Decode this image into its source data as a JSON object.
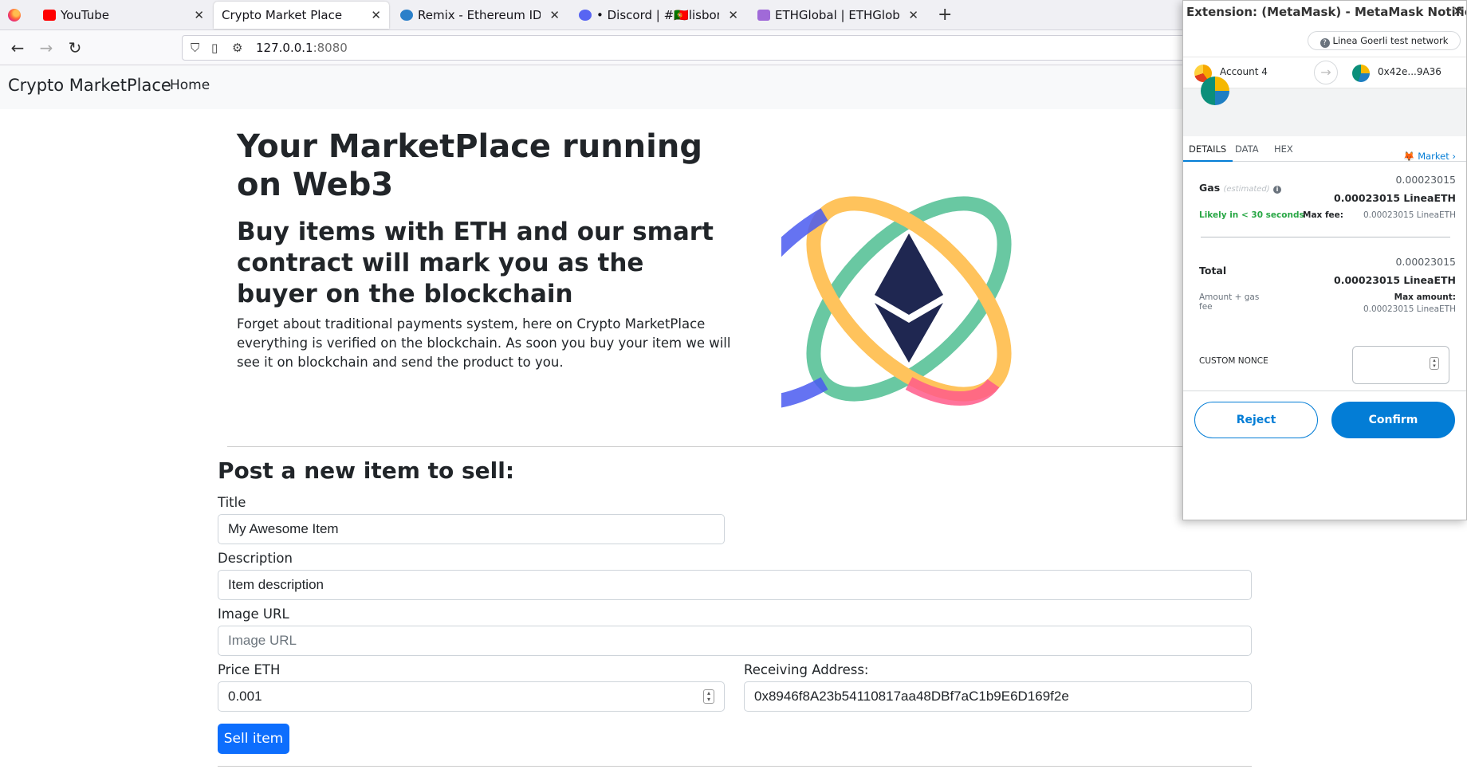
{
  "browser": {
    "tabs": [
      {
        "label": "YouTube",
        "fav_color": "#ff0000"
      },
      {
        "label": "Crypto Market Place",
        "fav_color": "",
        "active": true
      },
      {
        "label": "Remix - Ethereum IDE",
        "fav_color": "#2a7fc9"
      },
      {
        "label": "• Discord | #🇵🇹lisbon-chat",
        "fav_color": "#5865f2"
      },
      {
        "label": "ETHGlobal | ETHGlobal Li",
        "fav_color": "#a06ad8"
      }
    ],
    "url_host": "127.0.0.1",
    "url_port": ":8080"
  },
  "site": {
    "brand": "Crypto MarketPlace",
    "nav_home": "Home",
    "hero_title": "Your MarketPlace running on Web3",
    "hero_subtitle": "Buy items with ETH and our smart contract will mark you as the buyer on the blockchain",
    "hero_text": "Forget about traditional payments system, here on Crypto MarketPlace everything is verified on the blockchain. As soon you buy your item we will see it on blockchain and send the product to you."
  },
  "form": {
    "heading": "Post a new item to sell:",
    "title_label": "Title",
    "title_value": "My Awesome Item",
    "description_label": "Description",
    "description_value": "Item description",
    "image_label": "Image URL",
    "image_placeholder": "Image URL",
    "price_label": "Price ETH",
    "price_value": "0.001",
    "address_label": "Receiving Address:",
    "address_value": "0x8946f8A23b54110817aa48DBf7aC1b9E6D169f2e",
    "submit_label": "Sell item"
  },
  "metamask": {
    "window_title": "Extension: (MetaMask) - MetaMask Notifica...",
    "close": "✕",
    "network": "Linea Goerli test network",
    "from_account": "Account 4",
    "to_address": "0x42e...9A36",
    "tabs": [
      "DETAILS",
      "DATA",
      "HEX"
    ],
    "market_label": "Market",
    "gas_label": "Gas",
    "gas_estimated": "(estimated)",
    "gas_value": "0.00023015",
    "gas_value_eth": "0.00023015 LineaETH",
    "likely": "Likely in < 30 seconds",
    "max_fee_label": "Max fee:",
    "max_fee_value": "0.00023015 LineaETH",
    "total_label": "Total",
    "total_value": "0.00023015",
    "total_value_eth": "0.00023015 LineaETH",
    "amount_gas_label_1": "Amount + gas",
    "amount_gas_label_2": "fee",
    "max_amount_label": "Max amount:",
    "max_amount_value": "0.00023015 LineaETH",
    "custom_nonce_label": "CUSTOM NONCE",
    "reject_label": "Reject",
    "confirm_label": "Confirm",
    "accent": "#037dd6",
    "likely_color": "#28a745"
  }
}
